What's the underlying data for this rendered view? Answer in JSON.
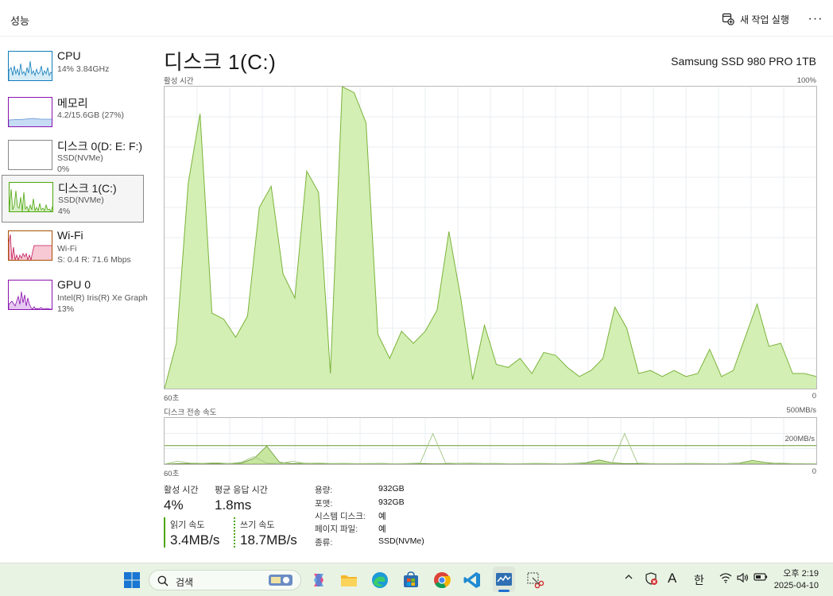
{
  "header": {
    "title": "성능",
    "new_task_label": "새 작업 실행",
    "more_label": "···"
  },
  "sidebar": {
    "items": [
      {
        "name": "CPU",
        "sub1": "14%  3.84GHz",
        "sub2": "",
        "color": "#117dbb"
      },
      {
        "name": "메모리",
        "sub1": "4.2/15.6GB (27%)",
        "sub2": "",
        "color": "#8b12ae"
      },
      {
        "name": "디스크 0(D: E: F:)",
        "sub1": "SSD(NVMe)",
        "sub2": "0%",
        "color": "#4da60c"
      },
      {
        "name": "디스크 1(C:)",
        "sub1": "SSD(NVMe)",
        "sub2": "4%",
        "color": "#4da60c"
      },
      {
        "name": "Wi-Fi",
        "sub1": "Wi-Fi",
        "sub2": "S: 0.4  R: 71.6 Mbps",
        "color": "#a74f01"
      },
      {
        "name": "GPU 0",
        "sub1": "Intel(R) Iris(R) Xe Graph",
        "sub2": "13%",
        "color": "#8b12ae"
      }
    ]
  },
  "main": {
    "title": "디스크 1(C:)",
    "model": "Samsung SSD 980 PRO 1TB",
    "chart1_label": "활성 시간",
    "chart1_max": "100%",
    "chart1_xstart": "60초",
    "chart1_xend": "0",
    "chart2_label": "디스크 전송 속도",
    "chart2_max": "500MB/s",
    "chart2_mid": "200MB/s",
    "chart2_xstart": "60초",
    "chart2_xend": "0"
  },
  "stats": {
    "active_label": "활성 시간",
    "active_value": "4%",
    "response_label": "평균 응답 시간",
    "response_value": "1.8ms",
    "read_label": "읽기 속도",
    "read_value": "3.4MB/s",
    "write_label": "쓰기 속도",
    "write_value": "18.7MB/s"
  },
  "info": [
    {
      "label": "용량:",
      "value": "932GB"
    },
    {
      "label": "포맷:",
      "value": "932GB"
    },
    {
      "label": "시스템 디스크:",
      "value": "예"
    },
    {
      "label": "페이지 파일:",
      "value": "예"
    },
    {
      "label": "종류:",
      "value": "SSD(NVMe)"
    }
  ],
  "taskbar": {
    "search_label": "검색",
    "ime_a": "A",
    "ime_han": "한",
    "time": "오후 2:19",
    "date": "2025-04-10"
  },
  "chart_data": [
    {
      "type": "area",
      "title": "활성 시간",
      "unit": "%",
      "ylim": [
        0,
        100
      ],
      "x_label_start": "60초",
      "x_label_end": "0",
      "series": [
        {
          "values": [
            0,
            15,
            68,
            91,
            25,
            23,
            17,
            24,
            60,
            67,
            38,
            30,
            72,
            65,
            5,
            100,
            98,
            88,
            18,
            10,
            19,
            15,
            19,
            26,
            52,
            30,
            3,
            21,
            8,
            7,
            10,
            5,
            12,
            11,
            7,
            4,
            6,
            10,
            27,
            20,
            5,
            6,
            4,
            6,
            4,
            5,
            13,
            4,
            6,
            17,
            28,
            14,
            15,
            5,
            5,
            4
          ]
        }
      ]
    },
    {
      "type": "line",
      "title": "디스크 전송 속도",
      "unit": "MB/s",
      "ylim": [
        0,
        500
      ],
      "reference_line": 200,
      "x_label_start": "60초",
      "x_label_end": "0",
      "series": [
        {
          "kind": "area",
          "values": [
            0,
            5,
            8,
            6,
            5,
            8,
            10,
            60,
            195,
            20,
            5,
            10,
            8,
            4,
            6,
            5,
            4,
            6,
            4,
            5,
            6,
            3,
            4,
            8,
            10,
            5,
            6,
            5,
            4,
            6,
            4,
            4,
            8,
            15,
            45,
            15,
            5,
            6,
            4,
            6,
            5,
            4,
            4,
            5,
            6,
            12,
            40,
            18,
            8,
            5,
            4,
            3
          ]
        },
        {
          "kind": "line",
          "values": [
            0,
            30,
            10,
            8,
            15,
            5,
            20,
            80,
            10,
            5,
            30,
            8,
            10,
            6,
            8,
            5,
            6,
            8,
            4,
            6,
            10,
            330,
            10,
            5,
            8,
            6,
            6,
            4,
            5,
            8,
            6,
            4,
            6,
            8,
            10,
            5,
            330,
            10,
            6,
            4,
            5,
            8,
            6,
            5,
            4,
            6,
            8,
            5,
            10,
            6,
            5,
            4
          ]
        }
      ]
    }
  ]
}
